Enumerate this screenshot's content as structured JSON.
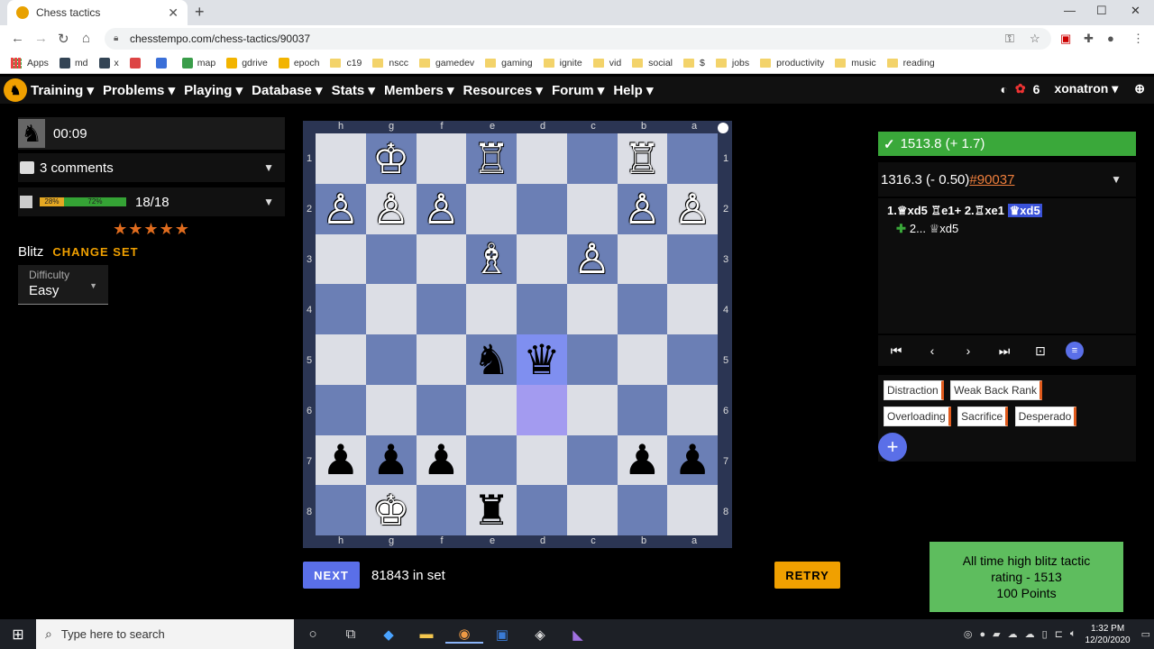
{
  "browser": {
    "tab_title": "Chess tactics",
    "url": "chesstempo.com/chess-tactics/90037",
    "bookmarks": [
      "Apps",
      "md",
      "x",
      "",
      "",
      "map",
      "gdrive",
      "epoch",
      "c19",
      "nscc",
      "gamedev",
      "gaming",
      "ignite",
      "vid",
      "social",
      "$",
      "jobs",
      "productivity",
      "music",
      "reading"
    ]
  },
  "nav": {
    "items": [
      "Training",
      "Problems",
      "Playing",
      "Database",
      "Stats",
      "Members",
      "Resources",
      "Forum",
      "Help"
    ],
    "count": "6",
    "username": "xonatron"
  },
  "left": {
    "timer": "00:09",
    "comments": "3 comments",
    "bar_fail_pct": "28%",
    "bar_pass_pct": "72%",
    "progress": "18/18",
    "stars": "★★★★★",
    "set_name": "Blitz",
    "change_set": "CHANGE SET",
    "difficulty_label": "Difficulty",
    "difficulty_value": "Easy"
  },
  "board": {
    "files": [
      "h",
      "g",
      "f",
      "e",
      "d",
      "c",
      "b",
      "a"
    ],
    "ranks": [
      "1",
      "2",
      "3",
      "4",
      "5",
      "6",
      "7",
      "8"
    ],
    "squares": [
      [
        "",
        "♔w",
        "",
        "♖w",
        "",
        "",
        "♖w",
        ""
      ],
      [
        "♙w",
        "♙w",
        "♙w",
        "",
        "",
        "",
        "♙w",
        "♙w"
      ],
      [
        "",
        "",
        "",
        "♗w",
        "",
        "♙w",
        "",
        ""
      ],
      [
        "",
        "",
        "",
        "",
        "",
        "",
        "",
        ""
      ],
      [
        "",
        "",
        "",
        "♞b",
        "♛b",
        "",
        "",
        ""
      ],
      [
        "",
        "",
        "",
        "",
        "",
        "",
        "",
        ""
      ],
      [
        "♟b",
        "♟b",
        "♟b",
        "",
        "",
        "",
        "♟b",
        "♟b"
      ],
      [
        "",
        "♚w",
        "",
        "♜b",
        "",
        "",
        "",
        ""
      ]
    ]
  },
  "actions": {
    "next_label": "NEXT",
    "in_set": "81843 in set",
    "retry_label": "RETRY"
  },
  "right": {
    "user_rating": "1513.8 (+ 1.7)",
    "problem_rating": "1316.3 (- 0.50)",
    "problem_link": "#90037",
    "moves_line1_a": "1.♕xd5 ♖e1+ 2.♖xe1 ",
    "moves_line1_sel": "♛xd5",
    "moves_line2": "2... ♕xd5",
    "tags": [
      "Distraction",
      "Weak Back Rank",
      "Overloading",
      "Sacrifice",
      "Desperado"
    ],
    "add_tag": "+"
  },
  "toast": {
    "line1": "All time high blitz tactic",
    "line2": "rating - 1513",
    "line3": "100 Points"
  },
  "taskbar": {
    "search_placeholder": "Type here to search",
    "time": "1:32 PM",
    "date": "12/20/2020"
  },
  "colors": {
    "board_light": "#dcdee5",
    "board_dark": "#6b7fb5",
    "accent_orange": "#f0a000",
    "accent_blue": "#5a6fe8",
    "success_green": "#3aa83a"
  }
}
